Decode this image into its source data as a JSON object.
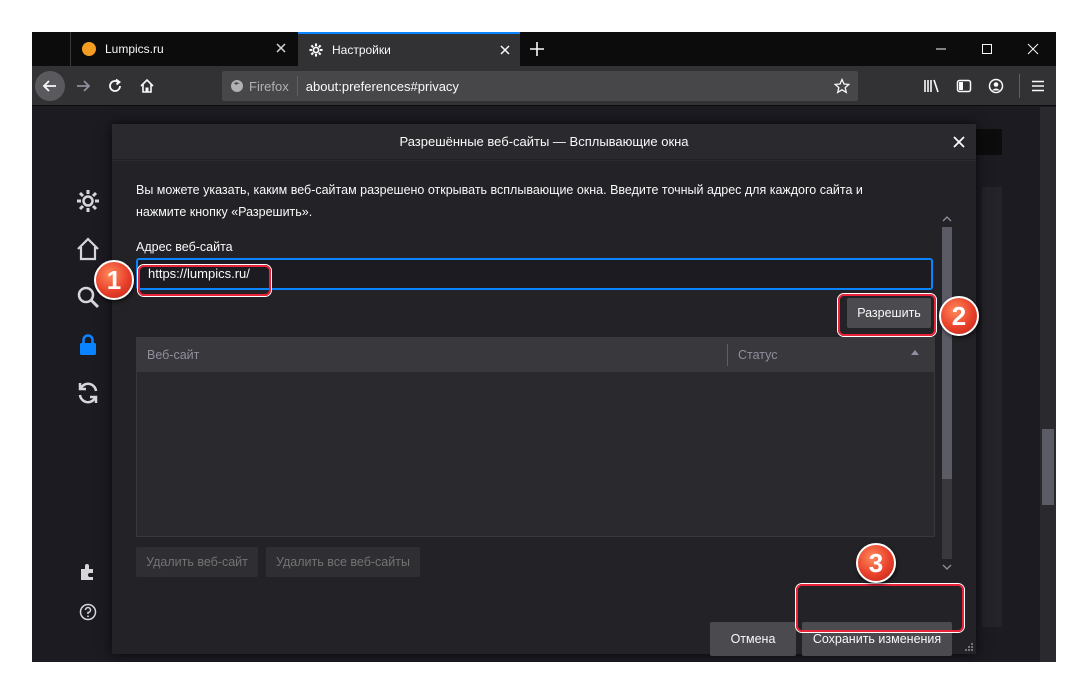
{
  "tabs": [
    {
      "title": "Lumpics.ru"
    },
    {
      "title": "Настройки"
    }
  ],
  "urlbar": {
    "identity_label": "Firefox",
    "url": "about:preferences#privacy"
  },
  "dialog": {
    "title": "Разрешённые веб-сайты — Всплывающие окна",
    "intro_line1": "Вы можете указать, каким веб-сайтам разрешено открывать всплывающие окна. Введите точный адрес для каждого сайта и",
    "intro_line2": "нажмите кнопку «Разрешить».",
    "address_label": "Адрес веб-сайта",
    "address_value": "https://lumpics.ru/",
    "allow_button": "Разрешить",
    "table": {
      "columns": [
        "Веб-сайт",
        "Статус"
      ],
      "rows": []
    },
    "remove_site_button": "Удалить веб-сайт",
    "remove_all_button": "Удалить все веб-сайты",
    "cancel_button": "Отмена",
    "save_button": "Сохранить изменения"
  },
  "annotations": [
    "1",
    "2",
    "3"
  ],
  "colors": {
    "accent": "#0a84ff",
    "highlight": "#e8233a",
    "badge": "#e8402a"
  }
}
